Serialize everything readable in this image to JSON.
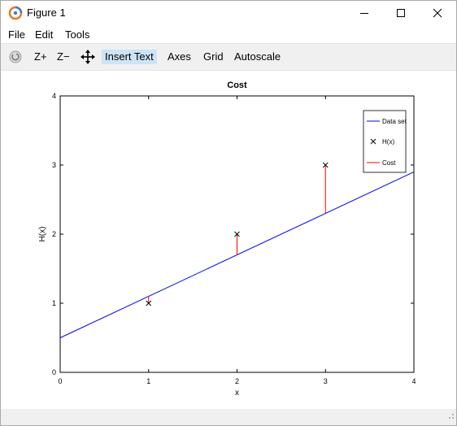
{
  "window": {
    "title": "Figure 1"
  },
  "menu": {
    "file": "File",
    "edit": "Edit",
    "tools": "Tools"
  },
  "toolbar": {
    "zoom_in": "Z+",
    "zoom_out": "Z−",
    "insert_text": "Insert Text",
    "axes": "Axes",
    "grid": "Grid",
    "autoscale": "Autoscale"
  },
  "chart_data": {
    "type": "line",
    "title": "Cost",
    "xlabel": "x",
    "ylabel": "H(x)",
    "xlim": [
      0,
      4
    ],
    "ylim": [
      0,
      4
    ],
    "xticks": [
      0,
      1,
      2,
      3,
      4
    ],
    "yticks": [
      0,
      1,
      2,
      3,
      4
    ],
    "grid": false,
    "legend_position": "top-right",
    "series": [
      {
        "name": "Data set",
        "kind": "line",
        "color": "#0000ff",
        "x": [
          0,
          4
        ],
        "y": [
          0.5,
          2.9
        ]
      },
      {
        "name": "H(x)",
        "kind": "marker-x",
        "color": "#000000",
        "x": [
          1,
          2,
          3
        ],
        "y": [
          1,
          2,
          3
        ]
      },
      {
        "name": "Cost",
        "kind": "vertical-segments",
        "color": "#ff0000",
        "x": [
          1,
          2,
          3
        ],
        "y_from": [
          1.1,
          1.7,
          2.3
        ],
        "y_to": [
          1,
          2,
          3
        ]
      }
    ]
  }
}
